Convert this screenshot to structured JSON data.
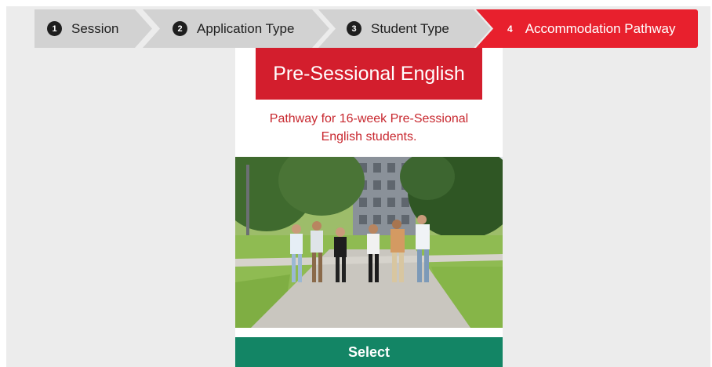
{
  "stepper": {
    "steps": [
      {
        "number": "1",
        "label": "Session"
      },
      {
        "number": "2",
        "label": "Application Type"
      },
      {
        "number": "3",
        "label": "Student Type"
      },
      {
        "number": "4",
        "label": "Accommodation Pathway"
      }
    ],
    "active_step": 4,
    "active_color": "#e8202d",
    "inactive_color": "#d2d2d2"
  },
  "card": {
    "title": "Pre-Sessional English",
    "description_line1": "Pathway for 16-week Pre-Sessional",
    "description_line2": "English students.",
    "image_alt": "students-walking-on-campus-photo",
    "select_label": "Select",
    "title_color": "#d31e2d",
    "button_color": "#138565"
  }
}
